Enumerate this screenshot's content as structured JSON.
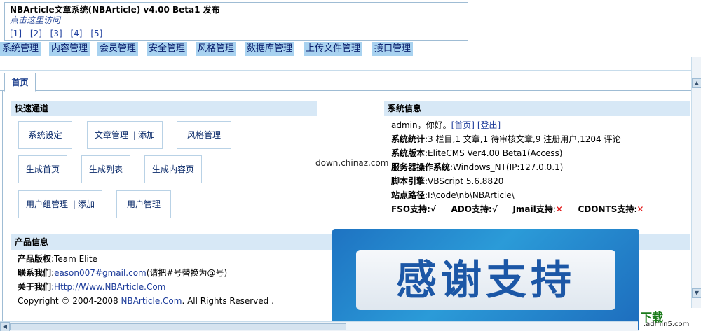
{
  "news": {
    "title": "NBArticle文章系统(NBArticle) v4.00 Beta1 发布",
    "visit_prefix": "点击",
    "visit_link": "这里访问",
    "pages": [
      "[1]",
      "[2]",
      "[3]",
      "[4]",
      "[5]"
    ]
  },
  "menu": [
    "系统管理",
    "内容管理",
    "会员管理",
    "安全管理",
    "风格管理",
    "数据库管理",
    "上传文件管理",
    "接口管理"
  ],
  "tab": {
    "label": "首页"
  },
  "quick": {
    "title": "快速通道",
    "system_settings": "系统设定",
    "article_manage": "文章管理",
    "article_sep": "|",
    "article_add": "添加",
    "style_manage": "风格管理",
    "gen_home": "生成首页",
    "gen_list": "生成列表",
    "gen_content": "生成内容页",
    "group_manage": "用户组管理",
    "group_sep": "|",
    "group_add": "添加",
    "user_manage": "用户管理"
  },
  "sysinfo": {
    "title": "系统信息",
    "greeting": "admin，你好。",
    "home_link": "[首页]",
    "logout_link": "[登出]",
    "stats_label": "系统统计",
    "stats_value": ":3 栏目,1 文章,1 待审核文章,9 注册用户,1204 评论",
    "version_label": "系统版本",
    "version_value": ":EliteCMS Ver4.00 Beta1(Access)",
    "os_label": "服务器操作系统",
    "os_value": ":Windows_NT(IP:127.0.0.1)",
    "engine_label": "脚本引擎",
    "engine_value": ":VBScript 5.6.8820",
    "path_label": "站点路径",
    "path_value": ":I:\\code\\nb\\NBArticle\\",
    "fso_label": "FSO支持",
    "fso_value": ":√",
    "ado_label": "ADO支持",
    "ado_value": ":√",
    "jmail_label": "Jmail支持",
    "jmail_value": "✕",
    "cdonts_label": "CDONTS支持",
    "cdonts_value": "✕"
  },
  "product": {
    "title": "产品信息",
    "copyright_label": "产品版权",
    "copyright_value": ":Team Elite",
    "contact_label": "联系我们",
    "contact_email": "eason007#gmail.com",
    "contact_note": "(请把#号替换为@号)",
    "about_label": "关于我们",
    "about_link": ":Http://Www.NBArticle.Com",
    "footer_prefix": "Copyright © 2004-2008 ",
    "footer_brand": "NBArticle.Com",
    "footer_suffix": ". All Rights Reserved ."
  },
  "watermark": "down.chinaz.com",
  "banner_text": "感谢支持",
  "logo": {
    "top": "下载",
    "bottom": ".admin5.com"
  },
  "colors": {
    "menu_bg": "#a8d2f0",
    "section_bg": "#d7e8f6",
    "link": "#1c3b9a",
    "cross": "#e01010"
  }
}
